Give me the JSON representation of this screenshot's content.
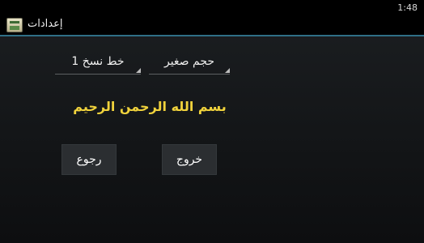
{
  "status_bar": {
    "time": "1:48"
  },
  "action_bar": {
    "title": "إعدادات",
    "icon": "app-icon"
  },
  "settings": {
    "font_spinner": {
      "selected": "خط نسخ 1"
    },
    "size_spinner": {
      "selected": "حجم صغير"
    },
    "preview_text": "بسم الله الرحمن الرحيم",
    "preview_color": "#f0d23c"
  },
  "buttons": {
    "back_label": "رجوع",
    "exit_label": "خروج"
  },
  "colors": {
    "accent_divider": "#2f6f86",
    "background": "#16181b"
  }
}
